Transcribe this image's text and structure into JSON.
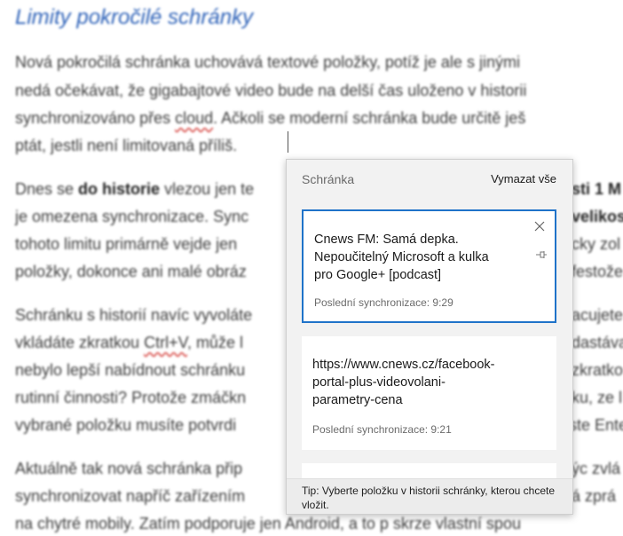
{
  "document": {
    "heading": "Limity pokročilé schránky",
    "lines": [
      "Nová pokročilá schránka uchovává textové položky, potíž je ale s jinými",
      "nedá očekávat, že gigabajtové video bude na delší čas uloženo v historii",
      "synchronizováno přes ",
      "cloud",
      ". Ačkoli se moderní schránka bude určitě ješ",
      "ptát, jestli není limitovaná příliš.",
      "Dnes se ",
      "do historie",
      " vlezou jen te",
      "sti 1 M",
      "je omezena synchronizace. Sync",
      "velikos",
      "tohoto limitu primárně vejde jen",
      "cky zol",
      "položky, dokonce ani malé obráz",
      "festože",
      "Schránku s historií navíc vyvoláte",
      "acujete",
      "vkládáte zkratkou ",
      "Ctrl+V",
      ", může l",
      "dastáva",
      "nebylo lepší nabídnout schránku",
      "zkratko",
      "rutinní činnosti? Protože zmáčkn",
      "ku, ze l",
      "vybrané položku musíte potvrdi",
      "iste Ente",
      "Aktuálně tak nová schránka přip",
      "ýc zvlá",
      "synchronizovat napříč zařízením",
      "á zprá",
      "na chytré mobily. Zatím podporuje jen Android, a to p skrze vlastní spou"
    ]
  },
  "clipboard": {
    "title": "Schránka",
    "clear_all_label": "Vymazat vše",
    "items": [
      {
        "lines": [
          "Cnews FM: Samá depka.",
          "Nepoučitelný Microsoft a kulka",
          "pro Google+ [podcast]"
        ],
        "sync": "Poslední synchronizace: 9:29",
        "selected": true
      },
      {
        "lines": [
          "https://www.cnews.cz/facebook-",
          "portal-plus-videovolani-",
          "parametry-cena"
        ],
        "sync": "Poslední synchronizace: 9:21",
        "selected": false
      }
    ],
    "tip": "Tip: Vyberte položku v historii schránky, kterou chcete vložit."
  },
  "colors": {
    "accent": "#1f73c9",
    "heading": "#2e62b8"
  },
  "icons": {
    "close": "close-icon",
    "pin": "pin-icon"
  }
}
